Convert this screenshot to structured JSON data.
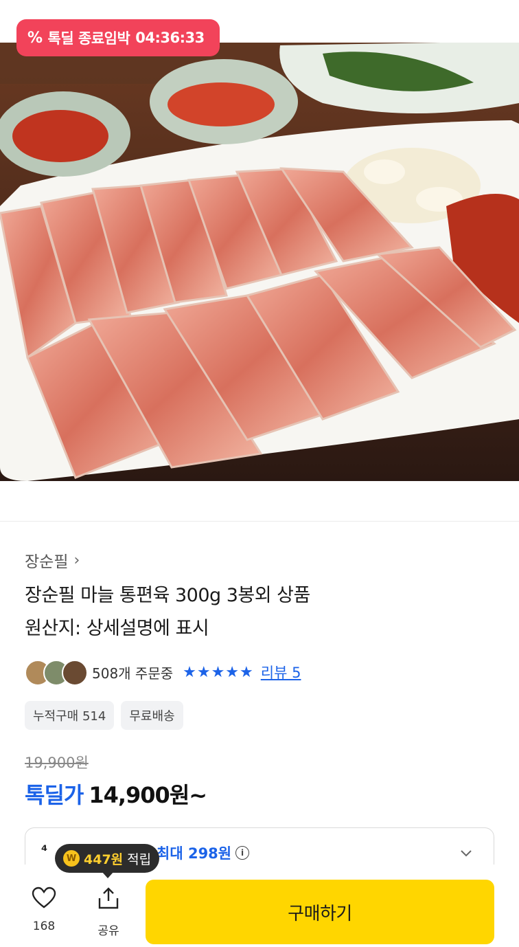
{
  "deal_badge": {
    "icon": "percent-icon",
    "label": "톡딜 종료임박",
    "timer": "04:36:33"
  },
  "product": {
    "brand": "장순필",
    "title_line1": "장순필 마늘 통편육 300g 3봉외 상품",
    "title_line2": "원산지: 상세설명에 표시",
    "orders": "508개 주문중",
    "rating_stars": "★★★★★",
    "review_link": "리뷰 5",
    "chips": [
      "누적구매 514",
      "무료배송"
    ],
    "original_price": "19,900원",
    "deal_label": "톡딜가",
    "deal_price": "14,900원~"
  },
  "benefit": {
    "max_text": "최대 298원",
    "info_icon": "info-icon"
  },
  "points_tooltip": {
    "amount": "447원",
    "suffix": "적립",
    "coin_symbol": "W"
  },
  "bottom_bar": {
    "favorite_count": "168",
    "share_label": "공유",
    "buy_label": "구매하기"
  },
  "colors": {
    "accent_blue": "#1c63e8",
    "badge_red": "#f2435a",
    "buy_yellow": "#ffd600"
  }
}
